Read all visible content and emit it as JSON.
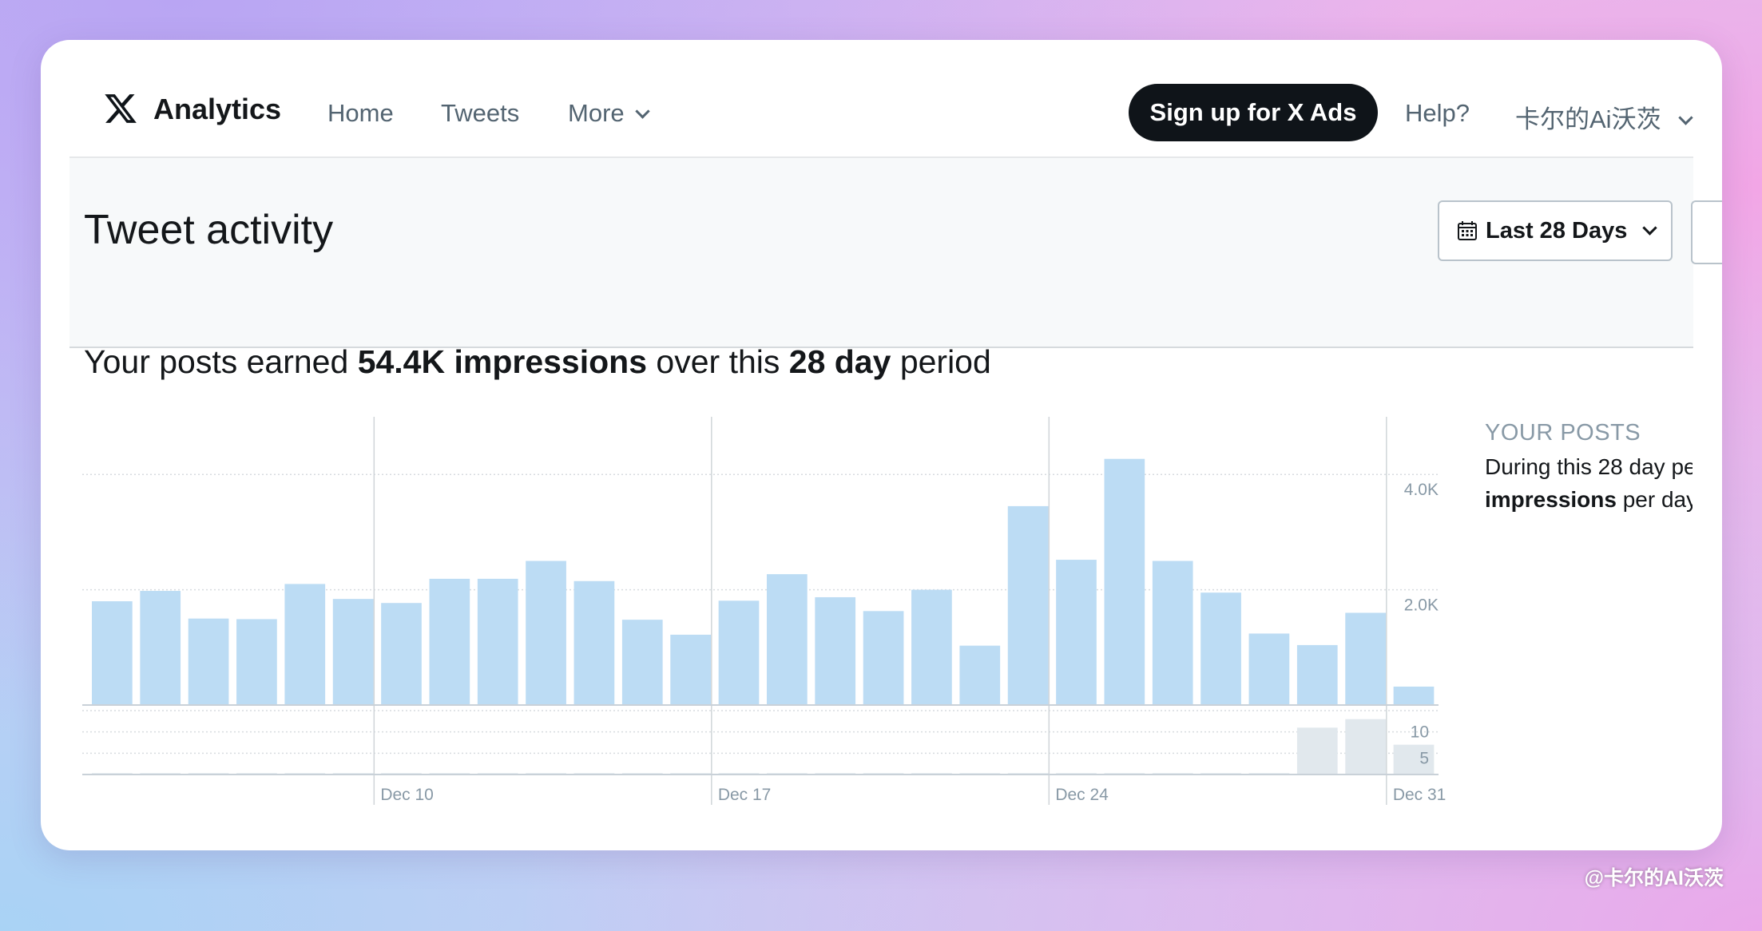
{
  "header": {
    "brand": "Analytics",
    "nav": [
      "Home",
      "Tweets",
      "More"
    ],
    "ads_button": "Sign up for X Ads",
    "help": "Help?",
    "user": "卡尔的Ai沃茨"
  },
  "activity": {
    "title": "Tweet activity",
    "range_label": "Last 28 Days",
    "summary": {
      "prefix": "Your posts earned ",
      "impressions": "54.4K impressions",
      "middle": " over this ",
      "days": "28 day",
      "suffix": " period"
    }
  },
  "sidebar": {
    "heading": "YOUR POSTS",
    "line1": "During this 28 day pe",
    "line2_bold": "impressions",
    "line2_rest": " per day"
  },
  "chart_data": {
    "type": "bar",
    "x_ticks": [
      "Dec 10",
      "Dec 17",
      "Dec 24",
      "Dec 31"
    ],
    "impressions": {
      "y_ticks": [
        "4.0K",
        "2.0K"
      ],
      "ylim": [
        0,
        5000
      ],
      "values": [
        1800,
        1980,
        1500,
        1490,
        2100,
        1840,
        1770,
        2190,
        2190,
        2500,
        2150,
        1480,
        1220,
        1810,
        2270,
        1870,
        1630,
        2000,
        1030,
        3450,
        2520,
        4270,
        2500,
        1950,
        1240,
        1040,
        1600,
        320
      ],
      "color": "#bcdcf4"
    },
    "engagements": {
      "y_ticks": [
        "10",
        "5"
      ],
      "ylim": [
        0,
        15
      ],
      "values": [
        0,
        0,
        0,
        0,
        0,
        0,
        0,
        0,
        0,
        0,
        0,
        0,
        0,
        0,
        0,
        0,
        0,
        0,
        0,
        0,
        0,
        0,
        0,
        0,
        0,
        11,
        13,
        7
      ],
      "color": "#e1e8ed"
    },
    "grid": true
  },
  "watermark": "@卡尔的AI沃茨",
  "colors": {
    "accent_dark": "#0f1419",
    "text_muted": "#536471",
    "bar_blue": "#bcdcf4"
  }
}
